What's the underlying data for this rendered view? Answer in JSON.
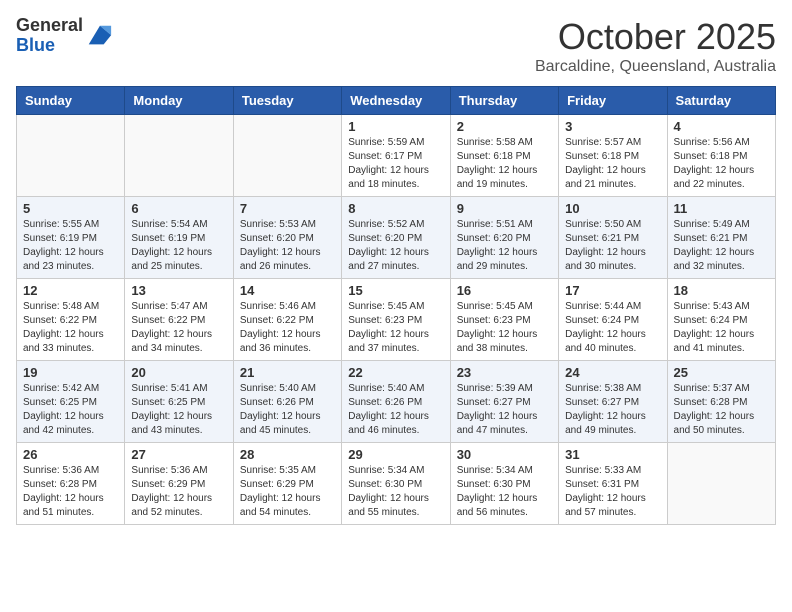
{
  "header": {
    "logo_general": "General",
    "logo_blue": "Blue",
    "title": "October 2025",
    "subtitle": "Barcaldine, Queensland, Australia"
  },
  "days_of_week": [
    "Sunday",
    "Monday",
    "Tuesday",
    "Wednesday",
    "Thursday",
    "Friday",
    "Saturday"
  ],
  "weeks": [
    [
      {
        "day": "",
        "sunrise": "",
        "sunset": "",
        "daylight": ""
      },
      {
        "day": "",
        "sunrise": "",
        "sunset": "",
        "daylight": ""
      },
      {
        "day": "",
        "sunrise": "",
        "sunset": "",
        "daylight": ""
      },
      {
        "day": "1",
        "sunrise": "Sunrise: 5:59 AM",
        "sunset": "Sunset: 6:17 PM",
        "daylight": "Daylight: 12 hours and 18 minutes."
      },
      {
        "day": "2",
        "sunrise": "Sunrise: 5:58 AM",
        "sunset": "Sunset: 6:18 PM",
        "daylight": "Daylight: 12 hours and 19 minutes."
      },
      {
        "day": "3",
        "sunrise": "Sunrise: 5:57 AM",
        "sunset": "Sunset: 6:18 PM",
        "daylight": "Daylight: 12 hours and 21 minutes."
      },
      {
        "day": "4",
        "sunrise": "Sunrise: 5:56 AM",
        "sunset": "Sunset: 6:18 PM",
        "daylight": "Daylight: 12 hours and 22 minutes."
      }
    ],
    [
      {
        "day": "5",
        "sunrise": "Sunrise: 5:55 AM",
        "sunset": "Sunset: 6:19 PM",
        "daylight": "Daylight: 12 hours and 23 minutes."
      },
      {
        "day": "6",
        "sunrise": "Sunrise: 5:54 AM",
        "sunset": "Sunset: 6:19 PM",
        "daylight": "Daylight: 12 hours and 25 minutes."
      },
      {
        "day": "7",
        "sunrise": "Sunrise: 5:53 AM",
        "sunset": "Sunset: 6:20 PM",
        "daylight": "Daylight: 12 hours and 26 minutes."
      },
      {
        "day": "8",
        "sunrise": "Sunrise: 5:52 AM",
        "sunset": "Sunset: 6:20 PM",
        "daylight": "Daylight: 12 hours and 27 minutes."
      },
      {
        "day": "9",
        "sunrise": "Sunrise: 5:51 AM",
        "sunset": "Sunset: 6:20 PM",
        "daylight": "Daylight: 12 hours and 29 minutes."
      },
      {
        "day": "10",
        "sunrise": "Sunrise: 5:50 AM",
        "sunset": "Sunset: 6:21 PM",
        "daylight": "Daylight: 12 hours and 30 minutes."
      },
      {
        "day": "11",
        "sunrise": "Sunrise: 5:49 AM",
        "sunset": "Sunset: 6:21 PM",
        "daylight": "Daylight: 12 hours and 32 minutes."
      }
    ],
    [
      {
        "day": "12",
        "sunrise": "Sunrise: 5:48 AM",
        "sunset": "Sunset: 6:22 PM",
        "daylight": "Daylight: 12 hours and 33 minutes."
      },
      {
        "day": "13",
        "sunrise": "Sunrise: 5:47 AM",
        "sunset": "Sunset: 6:22 PM",
        "daylight": "Daylight: 12 hours and 34 minutes."
      },
      {
        "day": "14",
        "sunrise": "Sunrise: 5:46 AM",
        "sunset": "Sunset: 6:22 PM",
        "daylight": "Daylight: 12 hours and 36 minutes."
      },
      {
        "day": "15",
        "sunrise": "Sunrise: 5:45 AM",
        "sunset": "Sunset: 6:23 PM",
        "daylight": "Daylight: 12 hours and 37 minutes."
      },
      {
        "day": "16",
        "sunrise": "Sunrise: 5:45 AM",
        "sunset": "Sunset: 6:23 PM",
        "daylight": "Daylight: 12 hours and 38 minutes."
      },
      {
        "day": "17",
        "sunrise": "Sunrise: 5:44 AM",
        "sunset": "Sunset: 6:24 PM",
        "daylight": "Daylight: 12 hours and 40 minutes."
      },
      {
        "day": "18",
        "sunrise": "Sunrise: 5:43 AM",
        "sunset": "Sunset: 6:24 PM",
        "daylight": "Daylight: 12 hours and 41 minutes."
      }
    ],
    [
      {
        "day": "19",
        "sunrise": "Sunrise: 5:42 AM",
        "sunset": "Sunset: 6:25 PM",
        "daylight": "Daylight: 12 hours and 42 minutes."
      },
      {
        "day": "20",
        "sunrise": "Sunrise: 5:41 AM",
        "sunset": "Sunset: 6:25 PM",
        "daylight": "Daylight: 12 hours and 43 minutes."
      },
      {
        "day": "21",
        "sunrise": "Sunrise: 5:40 AM",
        "sunset": "Sunset: 6:26 PM",
        "daylight": "Daylight: 12 hours and 45 minutes."
      },
      {
        "day": "22",
        "sunrise": "Sunrise: 5:40 AM",
        "sunset": "Sunset: 6:26 PM",
        "daylight": "Daylight: 12 hours and 46 minutes."
      },
      {
        "day": "23",
        "sunrise": "Sunrise: 5:39 AM",
        "sunset": "Sunset: 6:27 PM",
        "daylight": "Daylight: 12 hours and 47 minutes."
      },
      {
        "day": "24",
        "sunrise": "Sunrise: 5:38 AM",
        "sunset": "Sunset: 6:27 PM",
        "daylight": "Daylight: 12 hours and 49 minutes."
      },
      {
        "day": "25",
        "sunrise": "Sunrise: 5:37 AM",
        "sunset": "Sunset: 6:28 PM",
        "daylight": "Daylight: 12 hours and 50 minutes."
      }
    ],
    [
      {
        "day": "26",
        "sunrise": "Sunrise: 5:36 AM",
        "sunset": "Sunset: 6:28 PM",
        "daylight": "Daylight: 12 hours and 51 minutes."
      },
      {
        "day": "27",
        "sunrise": "Sunrise: 5:36 AM",
        "sunset": "Sunset: 6:29 PM",
        "daylight": "Daylight: 12 hours and 52 minutes."
      },
      {
        "day": "28",
        "sunrise": "Sunrise: 5:35 AM",
        "sunset": "Sunset: 6:29 PM",
        "daylight": "Daylight: 12 hours and 54 minutes."
      },
      {
        "day": "29",
        "sunrise": "Sunrise: 5:34 AM",
        "sunset": "Sunset: 6:30 PM",
        "daylight": "Daylight: 12 hours and 55 minutes."
      },
      {
        "day": "30",
        "sunrise": "Sunrise: 5:34 AM",
        "sunset": "Sunset: 6:30 PM",
        "daylight": "Daylight: 12 hours and 56 minutes."
      },
      {
        "day": "31",
        "sunrise": "Sunrise: 5:33 AM",
        "sunset": "Sunset: 6:31 PM",
        "daylight": "Daylight: 12 hours and 57 minutes."
      },
      {
        "day": "",
        "sunrise": "",
        "sunset": "",
        "daylight": ""
      }
    ]
  ]
}
